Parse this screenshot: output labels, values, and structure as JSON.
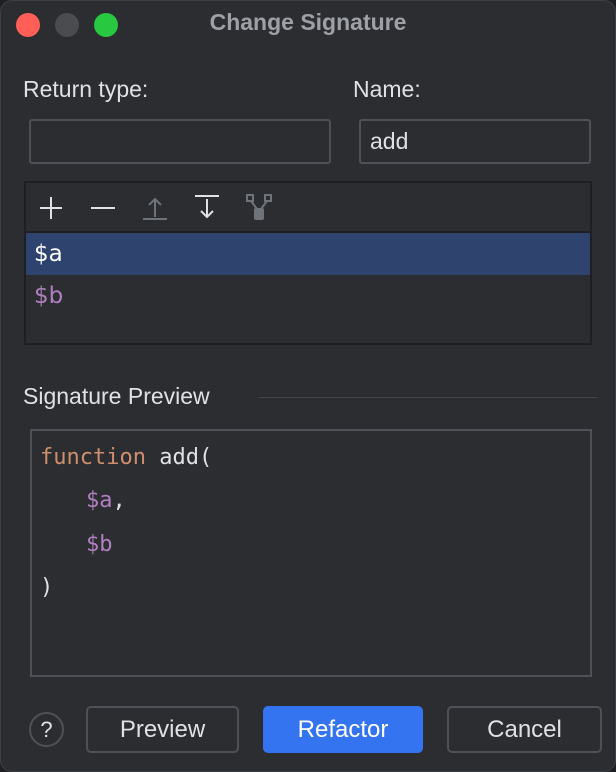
{
  "window": {
    "title": "Change Signature"
  },
  "form": {
    "return_type_label": "Return type:",
    "return_type_value": "",
    "name_label": "Name:",
    "name_value": "add"
  },
  "toolbar": {
    "icons": [
      "add-icon",
      "remove-icon",
      "move-up-icon",
      "move-down-icon",
      "propagate-icon"
    ]
  },
  "parameters": [
    {
      "name": "$a",
      "selected": true
    },
    {
      "name": "$b",
      "selected": false
    }
  ],
  "preview": {
    "section_label": "Signature Preview",
    "keyword": "function",
    "fn_open": " add(",
    "line2": "$a",
    "comma": ",",
    "line3": "$b",
    "close": ")"
  },
  "buttons": {
    "help": "?",
    "preview": "Preview",
    "refactor": "Refactor",
    "cancel": "Cancel"
  },
  "colors": {
    "accent": "#3574f0",
    "keyword": "#cf8e6d",
    "variable": "#b07fbf",
    "selection": "#2e436e"
  }
}
